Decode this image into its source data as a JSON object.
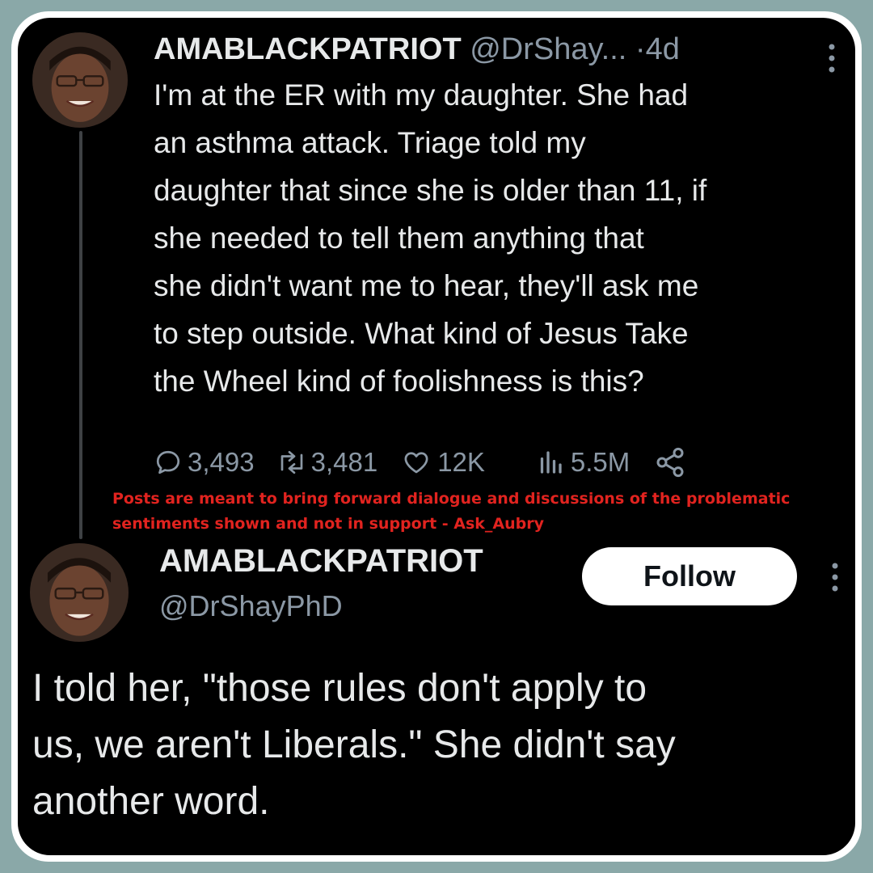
{
  "tweet1": {
    "display_name": "AMABLACKPATRIOT",
    "handle": "@DrShay...",
    "separator": "·",
    "time": "4d",
    "text": "I'm at the ER with my daughter. She had\nan asthma attack. Triage told my\ndaughter that since she is older than 11, if\nshe needed to tell them anything that\nshe didn't want me to hear, they'll ask me\nto step outside. What kind of Jesus Take\nthe Wheel kind of foolishness is this?",
    "stats": {
      "replies": "3,493",
      "reposts": "3,481",
      "likes": "12K",
      "views": "5.5M"
    },
    "icons": [
      "more-icon",
      "reply-icon",
      "repost-icon",
      "like-icon",
      "views-icon",
      "share-icon"
    ]
  },
  "disclaimer": "Posts are meant to bring forward dialogue and discussions of the problematic sentiments shown and not in support - Ask_Aubry",
  "tweet2": {
    "display_name": "AMABLACKPATRIOT",
    "handle": "@DrShayPhD",
    "follow_label": "Follow",
    "text": "I told her, \"those rules don't apply to\nus, we aren't Liberals.\" She didn't say\nanother word."
  },
  "colors": {
    "background": "#8aa8a8",
    "card": "#000000",
    "text": "#e7e9ea",
    "muted": "#8b98a5",
    "disclaimer": "#e1231f",
    "follow_bg": "#ffffff"
  }
}
